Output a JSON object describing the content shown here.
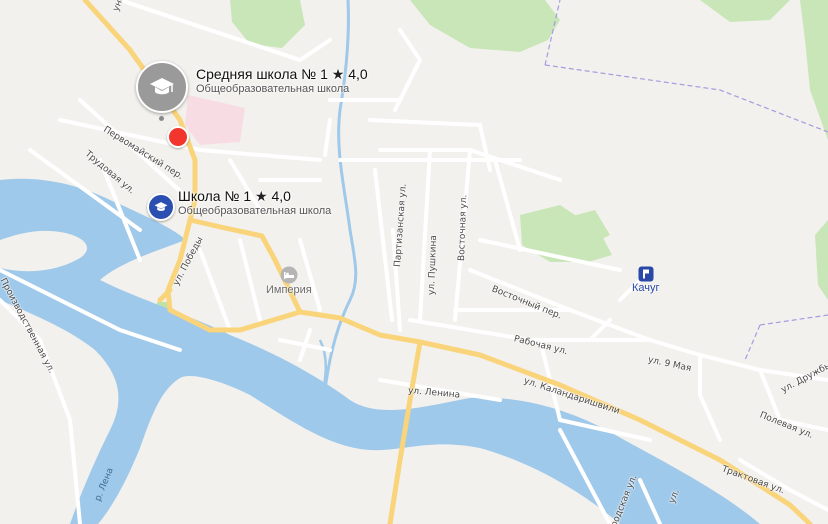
{
  "map": {
    "colors": {
      "background": "#f3f1ed",
      "water": "#9fc9ea",
      "forest": "#c9e6b8",
      "road_major": "#f9d47a",
      "road_minor": "#ffffff",
      "boundary": "#a69be0"
    }
  },
  "places": [
    {
      "name": "Средняя школа № 1",
      "rating": "4,0",
      "category": "Общеобразовательная школа",
      "icon": "graduation-cap-icon"
    },
    {
      "name": "Школа № 1",
      "rating": "4,0",
      "category": "Общеобразовательная школа",
      "icon": "graduation-cap-icon"
    }
  ],
  "pois": [
    {
      "name": "Империя",
      "icon": "hotel-bed-icon"
    },
    {
      "name": "Качуг",
      "icon": "bus-station-icon"
    }
  ],
  "street_labels": {
    "unskoy": "унской",
    "pervomaysky": "Первомайский пер.",
    "trudovaya": "Трудовая ул.",
    "pobedy": "ул. Победы",
    "proizvodstvennaya": "Производственная ул.",
    "partizanskaya": "Партизанская ул.",
    "pushkina": "ул. Пушкина",
    "vostochnaya": "Восточная ул.",
    "vostochny_per": "Восточный пер.",
    "rabochaya": "Рабочая ул.",
    "may9": "ул. 9 Мая",
    "kalandarashvili": "ул. Каландаришвили",
    "lenina": "ул. Ленина",
    "druzhby": "ул. Дружбы",
    "polevaya": "Полевая ул.",
    "traktovaya": "Трактовая ул.",
    "bottom_ul": "ул.",
    "gorodskaya": "родская ул."
  },
  "water_labels": {
    "lena": "р. Лена"
  }
}
